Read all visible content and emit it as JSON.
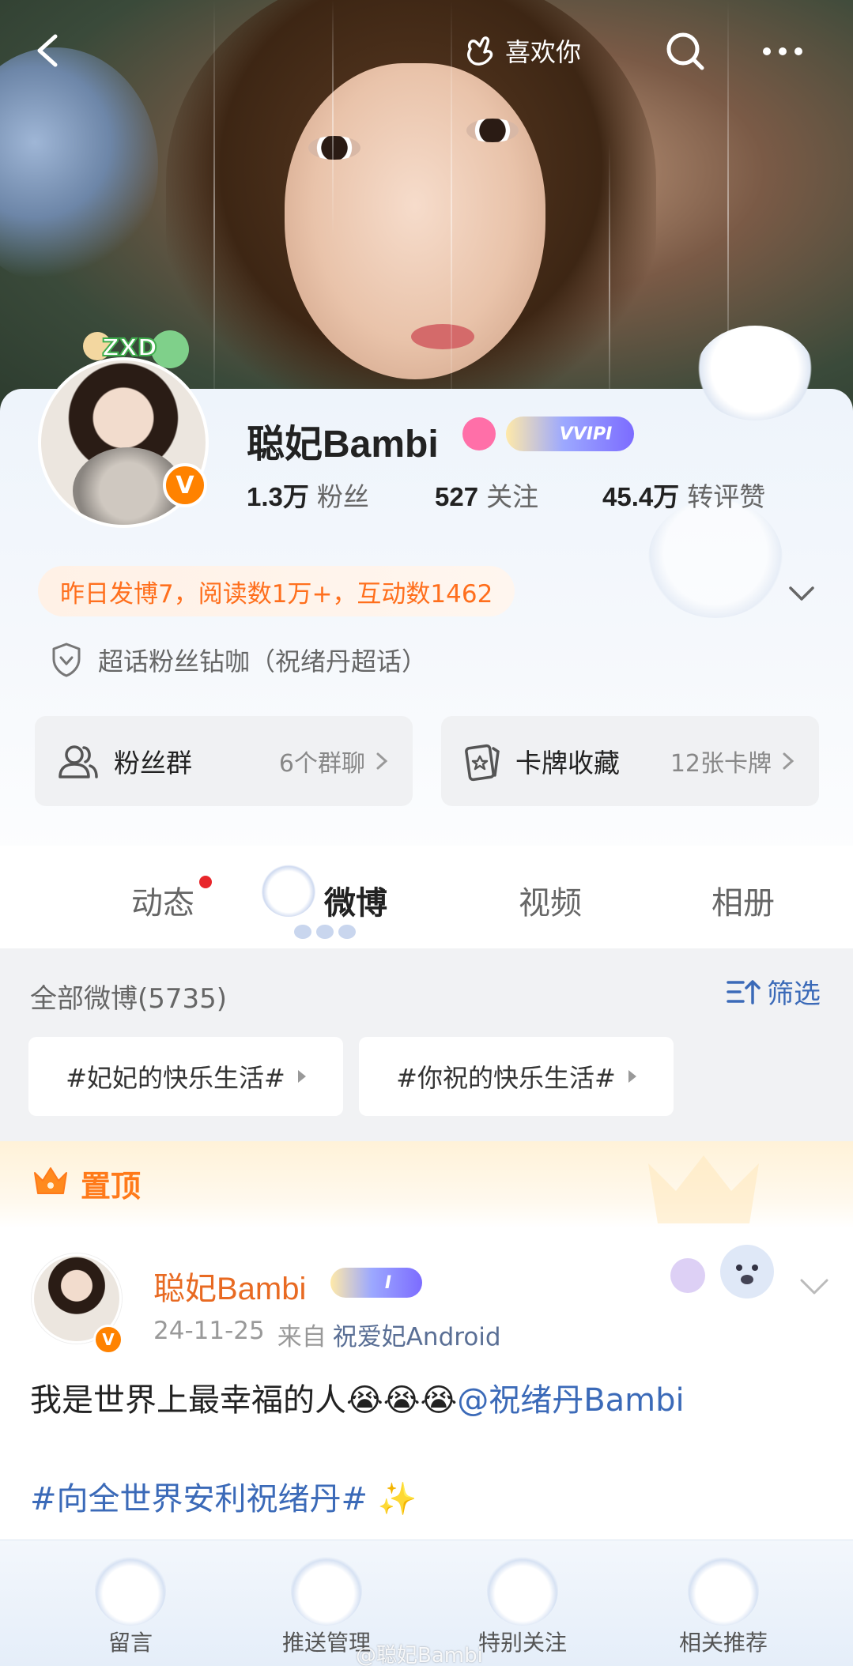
{
  "topbar": {
    "like_label": "喜欢你"
  },
  "profile": {
    "name": "聪妃Bambi",
    "vip_label": "VVIPI",
    "verified_mark": "V",
    "frame_text": "ZXD",
    "stats": [
      {
        "num": "1.3万",
        "label": "粉丝"
      },
      {
        "num": "527",
        "label": "关注"
      },
      {
        "num": "45.4万",
        "label": "转评赞"
      }
    ],
    "activity": "昨日发博7，阅读数1万+，互动数1462",
    "supertopic": "超话粉丝钻咖（祝绪丹超话）",
    "fan_group": {
      "title": "粉丝群",
      "sub": "6个群聊"
    },
    "cards": {
      "title": "卡牌收藏",
      "sub": "12张卡牌"
    }
  },
  "tabs": [
    {
      "label": "动态"
    },
    {
      "label": "微博"
    },
    {
      "label": "视频"
    },
    {
      "label": "相册"
    }
  ],
  "feed": {
    "count_label": "全部微博(5735)",
    "filter_label": "筛选",
    "tags": [
      "#妃妃的快乐生活#",
      "#你祝的快乐生活#"
    ]
  },
  "pinned": {
    "label": "置顶"
  },
  "post": {
    "name": "聪妃Bambi",
    "vip_label": "I",
    "date": "24-11-25",
    "from_label": "来自",
    "source": "祝爱妃Android",
    "text": "我是世界上最幸福的人😭😭😭",
    "mention": "@祝绪丹Bambi",
    "topic": "#向全世界安利祝绪丹# ✨"
  },
  "bottombar": {
    "items": [
      "留言",
      "推送管理",
      "特别关注",
      "相关推荐"
    ]
  },
  "watermark": "@聪妃Bambi",
  "colors": {
    "brand_orange": "#ff8200",
    "link_blue": "#3b6ab8",
    "activity_orange": "#ff6f1d"
  }
}
